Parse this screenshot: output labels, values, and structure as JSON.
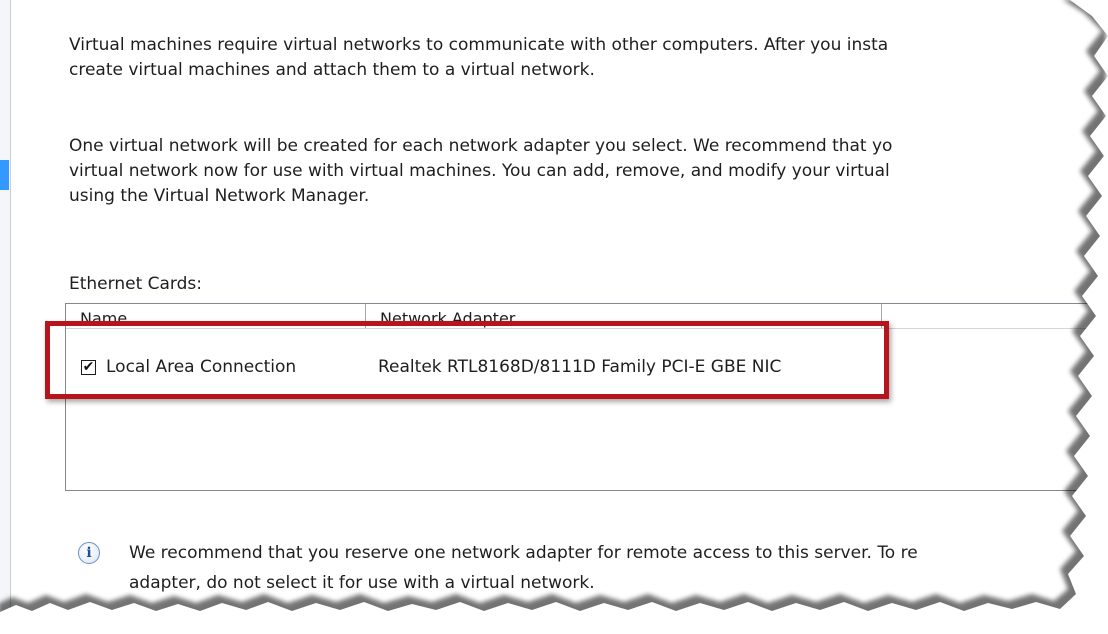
{
  "description": {
    "paragraph_1": [
      "Virtual machines require virtual networks to communicate with other computers. After you insta",
      "create virtual machines and attach them to a virtual network."
    ],
    "paragraph_2": [
      "One virtual network will be created for each network adapter you select. We recommend that yo",
      "virtual network now for use with virtual machines. You can add, remove, and modify your virtual",
      "using the Virtual Network Manager."
    ]
  },
  "ethernet_cards": {
    "label": "Ethernet Cards:",
    "columns": [
      "Name",
      "Network Adapter",
      ""
    ],
    "rows": [
      {
        "checked": true,
        "check_glyph": "✔",
        "name": "Local Area Connection",
        "adapter": "Realtek RTL8168D/8111D Family PCI-E GBE NIC"
      }
    ]
  },
  "info_note": {
    "icon": "info-icon",
    "glyph": "i",
    "lines": [
      "We recommend that you reserve one network adapter for remote access to this server. To re",
      "adapter, do not select it for use with a virtual network."
    ]
  },
  "colors": {
    "highlight_box": "#b8141c",
    "left_accent": "#3399ff",
    "info_icon_glyph": "#1c4f9c"
  }
}
